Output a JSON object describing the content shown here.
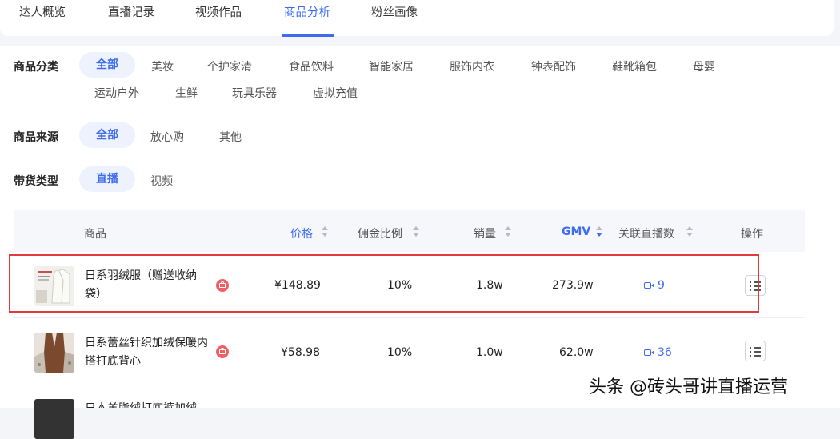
{
  "tabs": [
    {
      "label": "达人概览"
    },
    {
      "label": "直播记录"
    },
    {
      "label": "视频作品"
    },
    {
      "label": "商品分析"
    },
    {
      "label": "粉丝画像"
    }
  ],
  "active_tab": "商品分析",
  "filters": {
    "category": {
      "label": "商品分类",
      "options": [
        "全部",
        "美妆",
        "个护家清",
        "食品饮料",
        "智能家居",
        "服饰内衣",
        "钟表配饰",
        "鞋靴箱包",
        "母婴",
        "运动户外",
        "生鲜",
        "玩具乐器",
        "虚拟充值"
      ],
      "selected": "全部"
    },
    "source": {
      "label": "商品来源",
      "options": [
        "全部",
        "放心购",
        "其他"
      ],
      "selected": "全部"
    },
    "type": {
      "label": "带货类型",
      "options": [
        "直播",
        "视频"
      ],
      "selected": "直播"
    }
  },
  "table": {
    "columns": {
      "product": "商品",
      "price": "价格",
      "commission": "佣金比例",
      "sales": "销量",
      "gmv": "GMV",
      "linked_lives": "关联直播数",
      "actions": "操作"
    },
    "sorted_by": "GMV",
    "sort_direction": "descending",
    "rows": [
      {
        "name": "日系羽绒服（赠送收纳袋）",
        "price": "¥148.89",
        "commission": "10%",
        "sales": "1.8w",
        "gmv": "273.9w",
        "linked_lives": "9"
      },
      {
        "name": "日系蕾丝针织加绒保暖内搭打底背心",
        "price": "¥58.98",
        "commission": "10%",
        "sales": "1.0w",
        "gmv": "62.0w",
        "linked_lives": "36"
      },
      {
        "name": "日本羊脂绒打底裤加绒",
        "price": "",
        "commission": "",
        "sales": "",
        "gmv": "",
        "linked_lives": ""
      }
    ]
  },
  "watermark": "头条 @砖头哥讲直播运营",
  "colors": {
    "accent": "#3d6cf0",
    "highlight": "#e0393e",
    "shop_badge": "#ef5f66"
  },
  "icons": [
    "shop-badge-icon",
    "camera-icon",
    "list-icon",
    "sort-icon"
  ]
}
